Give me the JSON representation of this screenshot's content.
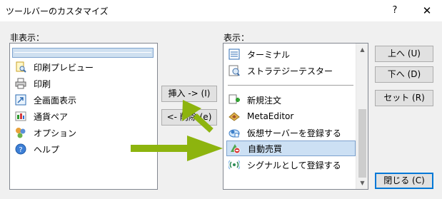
{
  "window": {
    "title": "ツールバーのカスタマイズ",
    "help_label": "?",
    "close_label": "✕"
  },
  "left_panel": {
    "label": "非表示：",
    "items": [
      {
        "label": "印刷プレビュー",
        "icon": "print-preview-icon"
      },
      {
        "label": "印刷",
        "icon": "printer-icon"
      },
      {
        "label": "全画面表示",
        "icon": "fullscreen-icon"
      },
      {
        "label": "通貨ペア",
        "icon": "currency-pair-icon"
      },
      {
        "label": "オプション",
        "icon": "options-icon"
      },
      {
        "label": "ヘルプ",
        "icon": "help-icon"
      }
    ]
  },
  "right_panel": {
    "label": "表示：",
    "items": [
      {
        "label": "ターミナル",
        "icon": "terminal-icon"
      },
      {
        "label": "ストラテジーテスター",
        "icon": "strategy-tester-icon"
      },
      {
        "label": "新規注文",
        "icon": "new-order-icon"
      },
      {
        "label": "MetaEditor",
        "icon": "metaeditor-icon"
      },
      {
        "label": "仮想サーバーを登録する",
        "icon": "virtual-server-icon"
      },
      {
        "label": "自動売買",
        "icon": "algo-trading-icon"
      },
      {
        "label": "シグナルとして登録する",
        "icon": "signal-icon"
      }
    ],
    "selected_item": "自動売買"
  },
  "buttons": {
    "insert": "挿入 -> (I)",
    "remove": "<- 削除 (e)",
    "up": "上へ (U)",
    "down": "下へ (D)",
    "reset": "セット (R)",
    "close": "閉じる (C)"
  },
  "colors": {
    "accent": "#0078d7",
    "selection": "#cce0f4",
    "annotation_arrow": "#8db40e"
  }
}
